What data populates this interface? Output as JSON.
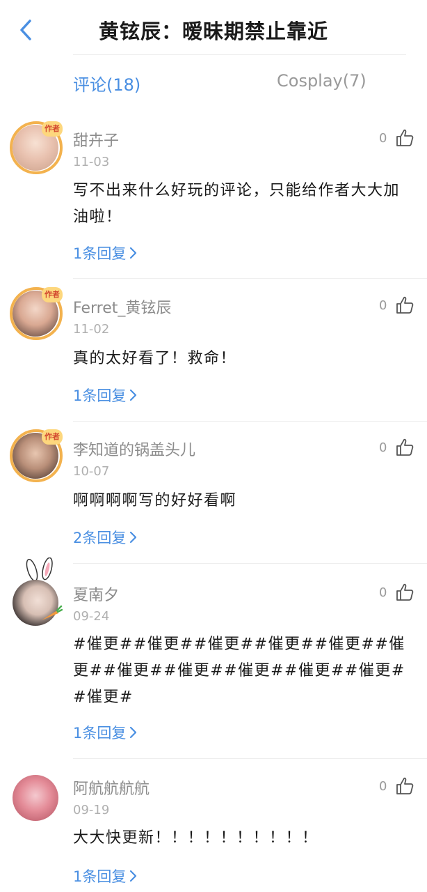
{
  "header": {
    "title": "黄铉辰：暧昧期禁止靠近",
    "back_icon": "chevron-left-icon",
    "accent": "#4a8fe2"
  },
  "tabs": [
    {
      "label": "评论(18)",
      "active": true
    },
    {
      "label": "Cosplay(7)",
      "active": false
    }
  ],
  "comments": [
    {
      "user": "甜卉子",
      "date": "11-03",
      "likes": "0",
      "text": "写不出来什么好玩的评论，只能给作者大大加油啦！",
      "reply": "1条回复",
      "badge": "作者"
    },
    {
      "user": "Ferret_黄铉辰",
      "date": "11-02",
      "likes": "0",
      "text": "真的太好看了！救命！",
      "reply": "1条回复",
      "badge": "作者"
    },
    {
      "user": "李知道的锅盖头儿",
      "date": "10-07",
      "likes": "0",
      "text": "啊啊啊啊写的好好看啊",
      "reply": "2条回复",
      "badge": "作者"
    },
    {
      "user": "夏南夕",
      "date": "09-24",
      "likes": "0",
      "text": "#催更##催更##催更##催更##催更##催更##催更##催更##催更##催更##催更##催更#",
      "reply": "1条回复"
    },
    {
      "user": "阿航航航航",
      "date": "09-19",
      "likes": "0",
      "text": "大大快更新！！！！！！！！！！",
      "reply": "1条回复"
    }
  ]
}
